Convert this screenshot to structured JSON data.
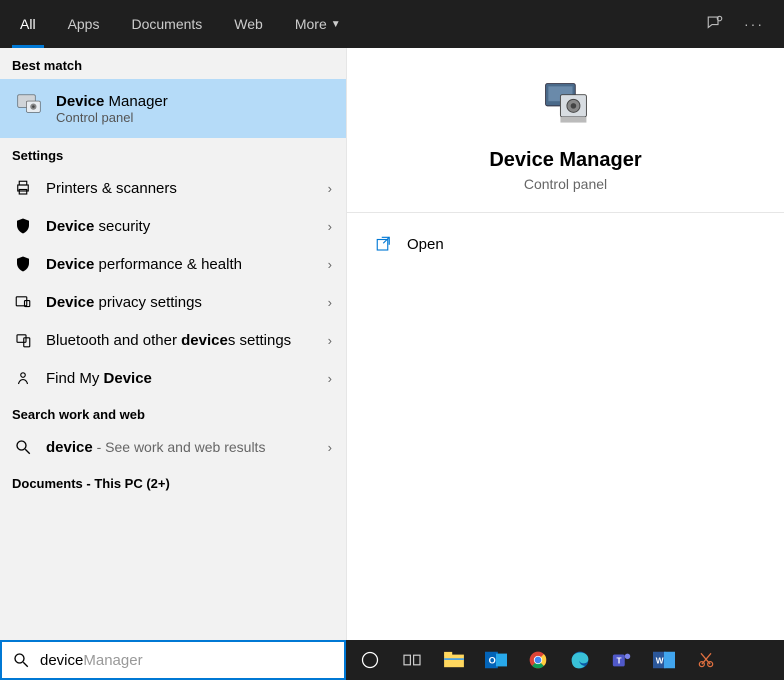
{
  "tabs": [
    "All",
    "Apps",
    "Documents",
    "Web",
    "More"
  ],
  "activeTab": 0,
  "sections": {
    "best": "Best match",
    "settings": "Settings",
    "searchweb": "Search work and web",
    "documents": "Documents - This PC (2+)"
  },
  "bestMatch": {
    "boldPart": "Device",
    "rest": " Manager",
    "subtitle": "Control panel"
  },
  "settingsItems": [
    {
      "icon": "printer",
      "text": "Printers & scanners",
      "bold": ""
    },
    {
      "icon": "shield",
      "bold": "Device",
      "text": " security"
    },
    {
      "icon": "shield",
      "bold": "Device",
      "text": " performance & health"
    },
    {
      "icon": "privacy",
      "bold": "Device",
      "text": " privacy settings"
    },
    {
      "icon": "bluetooth",
      "bold": "device",
      "text": "Bluetooth and other ",
      "text2": "s settings"
    },
    {
      "icon": "find",
      "bold": "Device",
      "text": "Find My "
    }
  ],
  "webItem": {
    "bold": "device",
    "suffix": " - See work and web results"
  },
  "preview": {
    "title": "Device Manager",
    "subtitle": "Control panel"
  },
  "actions": {
    "open": "Open"
  },
  "search": {
    "typed": "device",
    "ghost": "Manager"
  }
}
